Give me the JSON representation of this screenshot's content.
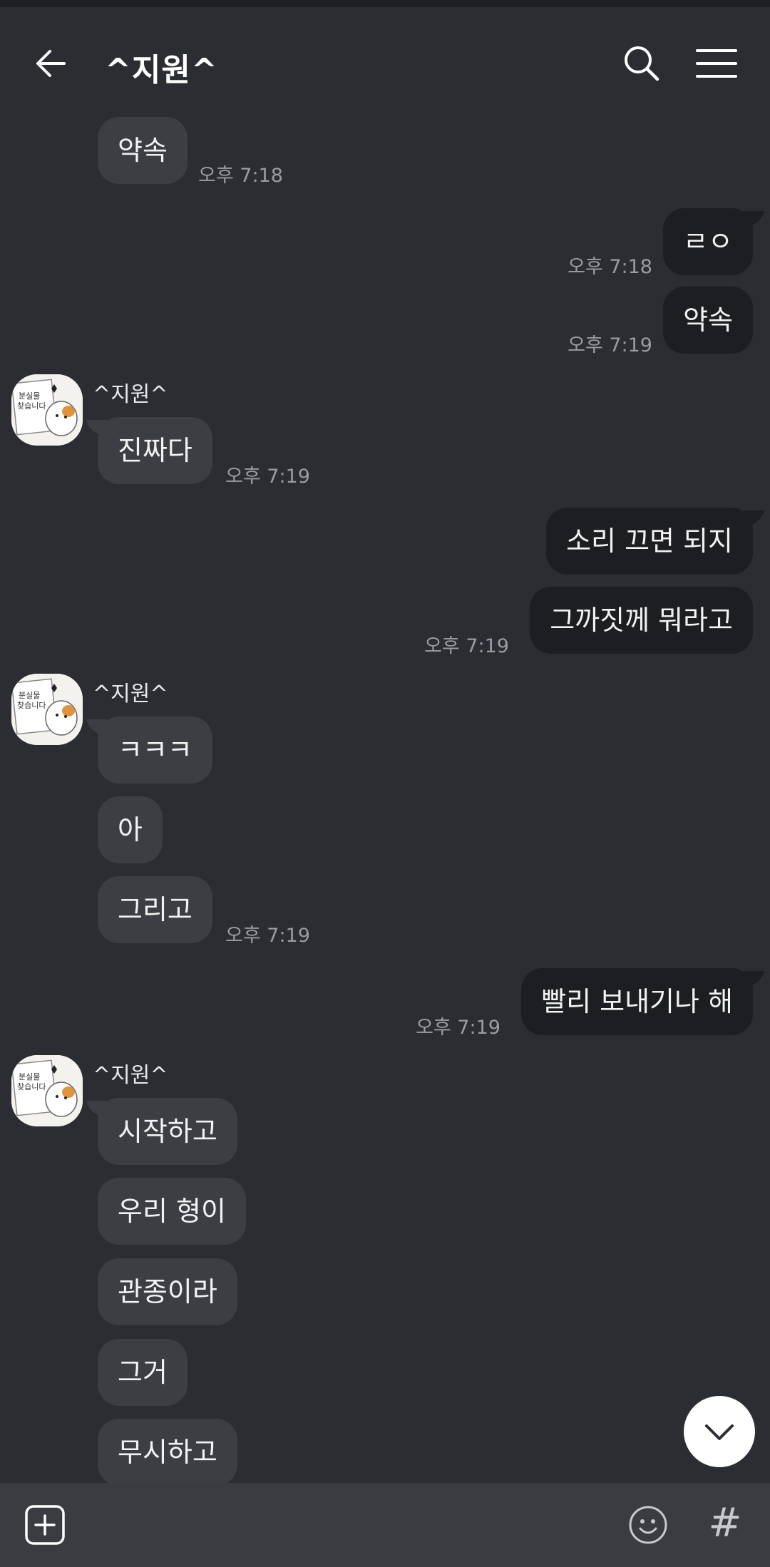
{
  "header": {
    "title": "^지원^"
  },
  "messages": {
    "m1": {
      "text": "약속",
      "time": "오후 7:18"
    },
    "m2": {
      "text": "ㄹㅇ",
      "time": "오후 7:18"
    },
    "m3": {
      "text": "약속",
      "time": "오후 7:19"
    },
    "g1": {
      "sender": "^지원^",
      "m4": "진짜다",
      "time": "오후 7:19"
    },
    "m5": {
      "text": "소리 끄면 되지"
    },
    "m6": {
      "text": "그까짓께 뭐라고",
      "time": "오후 7:19"
    },
    "g2": {
      "sender": "^지원^",
      "m7": "ㅋㅋㅋ",
      "m8": "아",
      "m9": "그리고",
      "time": "오후 7:19"
    },
    "m10": {
      "text": "빨리 보내기나 해",
      "time": "오후 7:19"
    },
    "g3": {
      "sender": "^지원^",
      "m11": "시작하고",
      "m12": "우리 형이",
      "m13": "관종이라",
      "m14": "그거",
      "m15": "무시하고"
    }
  },
  "avatar": {
    "line1": "분실물",
    "line2": "찾습니다"
  },
  "icons": {
    "back": "arrow-left-icon",
    "search": "search-icon",
    "menu": "hamburger-menu-icon",
    "scroll": "chevron-down-icon",
    "attach": "plus-square-icon",
    "emoji": "emoji-smile-icon",
    "hash": "#"
  },
  "colors": {
    "background": "#2b2d33",
    "incoming_bubble": "#3c3e44",
    "outgoing_bubble": "#1d1e22",
    "input_bar": "#3a3c42"
  }
}
